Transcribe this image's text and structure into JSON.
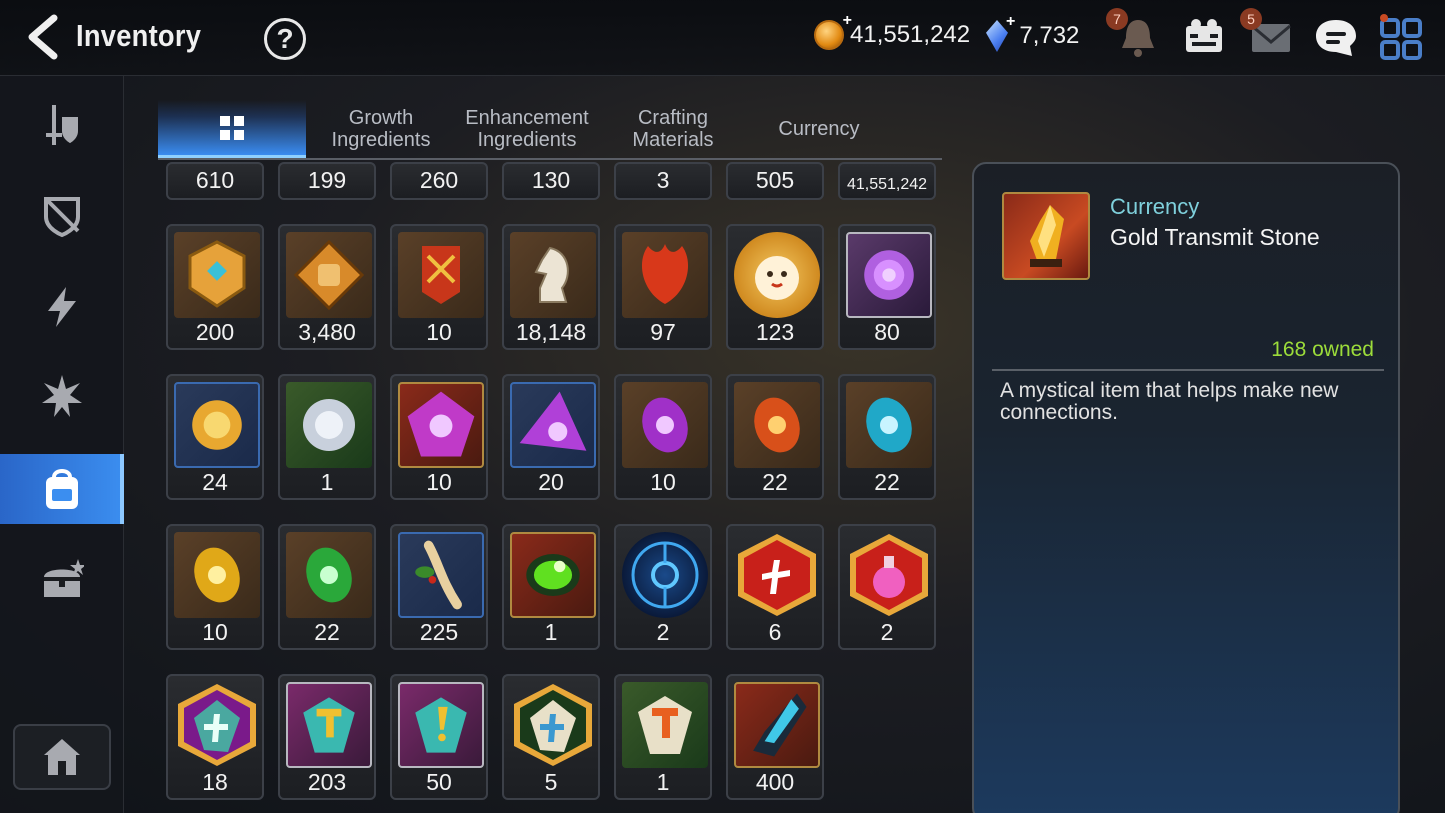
{
  "header": {
    "title": "Inventory",
    "help_symbol": "?",
    "gold": "41,551,242",
    "crystals": "7,732",
    "plus_symbol": "+",
    "notifications_badge": "7",
    "mail_badge": "5"
  },
  "tabs": [
    {
      "label": "",
      "icon": "grid-icon",
      "active": true
    },
    {
      "label": "Growth\nIngredients"
    },
    {
      "label": "Enhancement\nIngredients"
    },
    {
      "label": "Crafting\nMaterials"
    },
    {
      "label": "Currency"
    }
  ],
  "sidebar": [
    {
      "icon": "sword-shield-icon"
    },
    {
      "icon": "broken-shield-icon"
    },
    {
      "icon": "lightning-icon"
    },
    {
      "icon": "burst-icon"
    },
    {
      "icon": "backpack-icon",
      "active": true
    },
    {
      "icon": "treasure-chest-icon"
    },
    {
      "icon": "house-icon"
    }
  ],
  "grid": {
    "row0": [
      "610",
      "199",
      "260",
      "130",
      "3",
      "505",
      "41,551,242"
    ],
    "row1": [
      "200",
      "3,480",
      "10",
      "18,148",
      "97",
      "123",
      "80"
    ],
    "row2": [
      "24",
      "1",
      "10",
      "20",
      "10",
      "22",
      "22"
    ],
    "row3": [
      "10",
      "22",
      "225",
      "1",
      "2",
      "6",
      "2"
    ],
    "row4": [
      "18",
      "203",
      "50",
      "5",
      "1",
      "400"
    ]
  },
  "detail": {
    "category": "Currency",
    "name": "Gold Transmit Stone",
    "owned": "168 owned",
    "description": "A mystical item that helps make new connections."
  },
  "colors": {
    "accent_blue": "#3b8ef0",
    "owned_green": "#9cdc3a",
    "category_teal": "#7fd0dc"
  }
}
